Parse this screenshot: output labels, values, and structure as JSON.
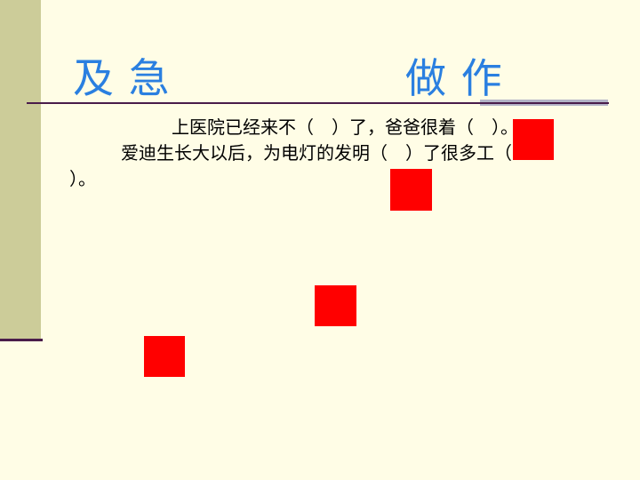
{
  "title": {
    "word1": "及 急",
    "word2": "做 作"
  },
  "body": {
    "line1": "上医院已经来不（　）了，爸爸很着（　）。",
    "line2": "爱迪生长大以后，为电灯的发明（　）了很多工（",
    "line3": "）。"
  },
  "colors": {
    "background": "#fffde6",
    "sidebar": "#cccc99",
    "title": "#2a7fe0",
    "accent_line": "#4a1c4a",
    "red_blocks": "#ff0000"
  }
}
